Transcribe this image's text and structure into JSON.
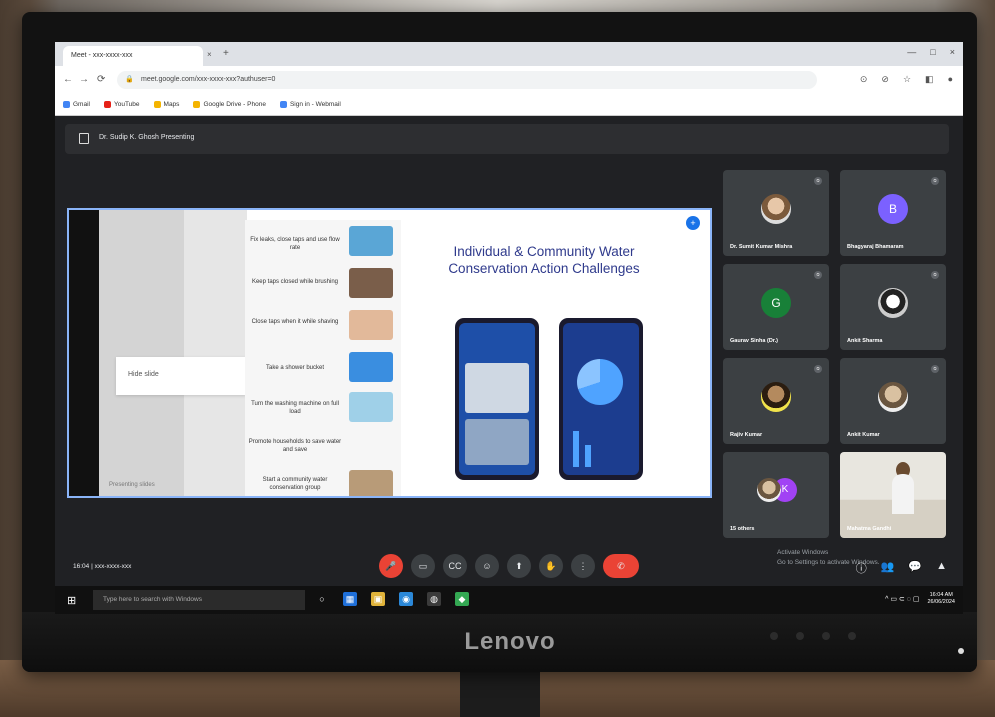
{
  "browser": {
    "tab_title": "Meet - xxx-xxxx-xxx",
    "tab_close": "×",
    "new_tab": "+",
    "window_controls": [
      "—",
      "□",
      "×"
    ],
    "nav": [
      "←",
      "→",
      "⟳"
    ],
    "url": "meet.google.com/xxx-xxxx-xxx?authuser=0",
    "toolbar_icons": [
      "⊙",
      "⊘",
      "☆",
      "◧",
      "●"
    ],
    "bookmarks": [
      {
        "label": "Gmail",
        "color": "#4285f4"
      },
      {
        "label": "YouTube",
        "color": "#e62117"
      },
      {
        "label": "Maps",
        "color": "#f4b400"
      },
      {
        "label": "Google Drive - Phone",
        "color": "#f4b400"
      },
      {
        "label": "Sign in - Webmail",
        "color": "#4285f4"
      }
    ]
  },
  "meet": {
    "title": "Dr. Sudip K. Ghosh Presenting",
    "presentation": {
      "hover_text": "Hide slide",
      "footer": "Presenting slides",
      "pin": "+",
      "tips": [
        "Fix leaks, close taps and use flow rate",
        "Keep taps closed while brushing",
        "Close taps when it while shaving",
        "Take a shower bucket",
        "Turn the washing machine on full load",
        "Promote households to save water and save",
        "Start a community water conservation group"
      ],
      "slide_title": "Individual & Community Water Conservation Action Challenges"
    },
    "participants": [
      {
        "name": "Dr. Sumit Kumar Mishra",
        "initial": "",
        "color": ""
      },
      {
        "name": "Bhagyaraj Bhamaram",
        "initial": "B",
        "color": "#7b61ff"
      },
      {
        "name": "Gaurav Sinha (Dr.)",
        "initial": "G",
        "color": "#188038"
      },
      {
        "name": "Ankit Sharma",
        "initial": "",
        "color": ""
      },
      {
        "name": "Rajiv Kumar",
        "initial": "",
        "color": ""
      },
      {
        "name": "Ankit Kumar",
        "initial": "",
        "color": ""
      },
      {
        "name": "15 others",
        "initial": "K",
        "color": "#a142f4"
      },
      {
        "name": "Mahatma Gandhi",
        "initial": "",
        "color": ""
      }
    ],
    "bottom": {
      "meeting_info": "16:04 | xxx-xxxx-xxx",
      "activate": [
        "Activate Windows",
        "Go to Settings to activate Windows."
      ],
      "controls": [
        "🎤",
        "▭",
        "CC",
        "☺",
        "⬆",
        "✋",
        "⋮",
        "✆"
      ],
      "right_controls": [
        "ⓘ",
        "👥",
        "💬",
        "▲"
      ]
    }
  },
  "taskbar": {
    "start": "⊞",
    "search_placeholder": "Type here to search with Windows",
    "icons": [
      "○",
      "▦",
      "▣",
      "◉",
      "◍",
      "◆"
    ],
    "tray": "^ ▭ ⊂ ◌ ▢",
    "time": "16:04 AM",
    "date": "26/06/2024"
  },
  "monitor": {
    "brand": "Lenovo"
  }
}
